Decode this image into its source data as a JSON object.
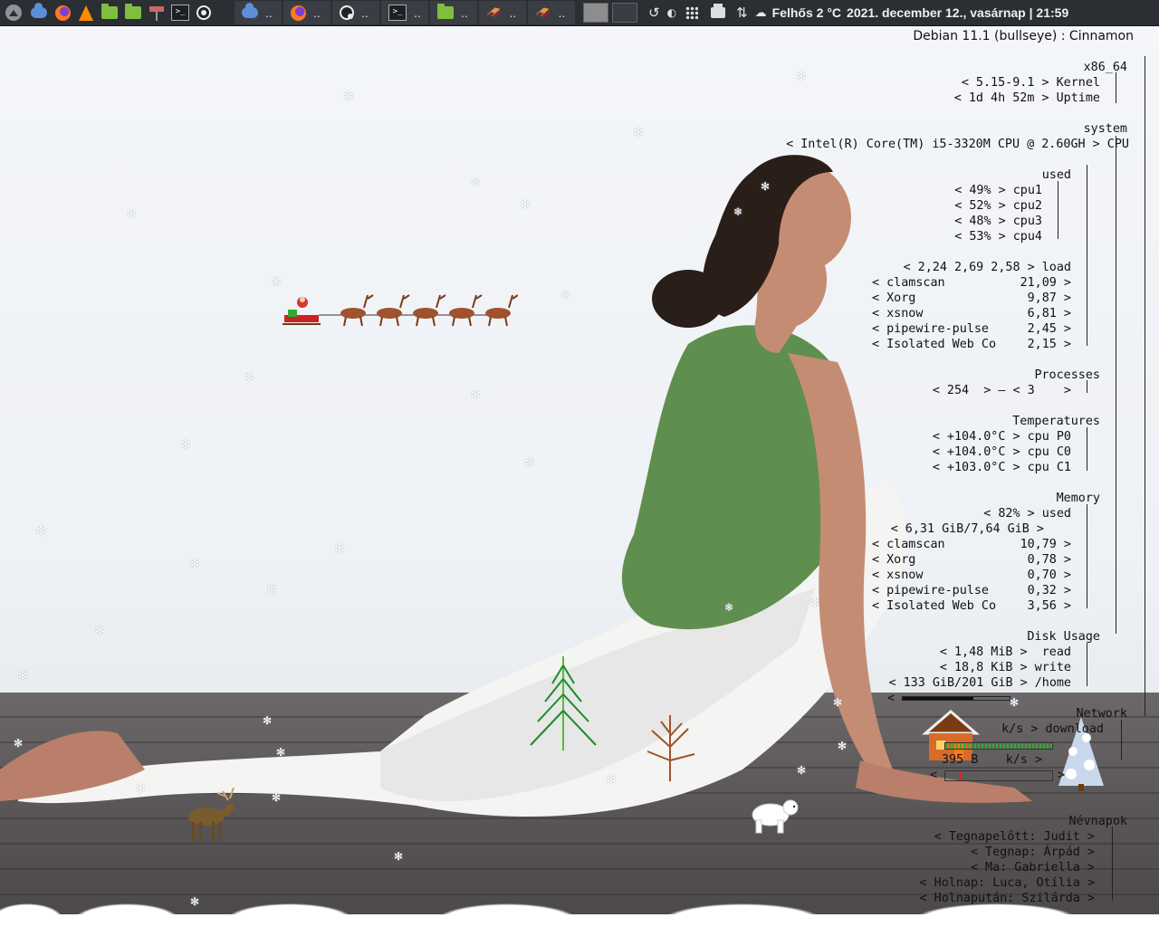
{
  "panel": {
    "launchers": [
      {
        "icon": "cloud-app-icon"
      },
      {
        "icon": "firefox-icon"
      },
      {
        "icon": "vlc-icon"
      },
      {
        "icon": "folder-icon"
      },
      {
        "icon": "folder-icon"
      },
      {
        "icon": "signpost-icon"
      },
      {
        "icon": "terminal-icon"
      },
      {
        "icon": "obs-icon"
      }
    ],
    "tasks": [
      {
        "icon": "cloud-app-icon",
        "label": ".."
      },
      {
        "icon": "firefox-icon",
        "label": ".."
      },
      {
        "icon": "obs-icon",
        "label": ".."
      },
      {
        "icon": "terminal-icon",
        "label": ".."
      },
      {
        "icon": "folder-icon",
        "label": ".."
      },
      {
        "icon": "sleigh-icon",
        "label": ".."
      },
      {
        "icon": "sleigh-icon",
        "label": ".."
      }
    ],
    "tray": {
      "weather": "Felhős 2 °C",
      "clock": "2021. december 12., vasárnap | 21:59"
    },
    "colors": {
      "panel": "#2b2e33",
      "text": "#eef0f3"
    }
  },
  "conky": {
    "os": "Debian 11.1 (bullseye)  :  Cinnamon",
    "arch": "x86_64",
    "kernel": "< 5.15-9.1 > Kernel",
    "uptime": "< 1d 4h 52m > Uptime",
    "system_label": "system",
    "cpu": "< Intel(R) Core(TM) i5-3320M CPU @ 2.60GH > CPU",
    "used_label": "used",
    "cpus": [
      "< 49% > cpu1",
      "< 52% > cpu2",
      "< 48% > cpu3",
      "< 53% > cpu4"
    ],
    "load": "< 2,24 2,69 2,58 > load",
    "cpu_procs": [
      {
        "name": "< clamscan",
        "value": "21,09 >"
      },
      {
        "name": "< Xorg",
        "value": "9,87 >"
      },
      {
        "name": "< xsnow",
        "value": "6,81 >"
      },
      {
        "name": "< pipewire-pulse",
        "value": "2,45 >"
      },
      {
        "name": "< Isolated Web Co",
        "value": "2,15 >"
      }
    ],
    "processes_label": "Processes",
    "processes": "< 254  > — < 3    >",
    "temps_label": "Temperatures",
    "temps": [
      "< +104.0°C > cpu P0",
      "< +104.0°C > cpu C0",
      "< +103.0°C > cpu C1"
    ],
    "memory_label": "Memory",
    "mem_used": "< 82% > used",
    "mem_total": "< 6,31 GiB/7,64 GiB >",
    "mem_procs": [
      {
        "name": "< clamscan",
        "value": "10,79 >"
      },
      {
        "name": "< Xorg",
        "value": "0,78 >"
      },
      {
        "name": "< xsnow",
        "value": "0,70 >"
      },
      {
        "name": "< pipewire-pulse",
        "value": "0,32 >"
      },
      {
        "name": "< Isolated Web Co",
        "value": "3,56 >"
      }
    ],
    "disk_label": "Disk Usage",
    "disk_read": "< 1,48 MiB >  read",
    "disk_write": "< 18,8 KiB > write",
    "disk_home": "< 133 GiB/201 GiB > /home",
    "disk_home_fraction": 0.66,
    "network_label": "Network",
    "net_down": "k/s > download",
    "net_up_value": "395 B",
    "net_up": "k/s >",
    "nevnapok_label": "Névnapok",
    "nevnapok": [
      "< Tegnapelőtt: Judit >",
      "< Tegnap: Árpád >",
      "< Ma: Gabriella >",
      "< Holnap: Luca, Otília >",
      "< Holnapután: Szilárda >"
    ]
  }
}
